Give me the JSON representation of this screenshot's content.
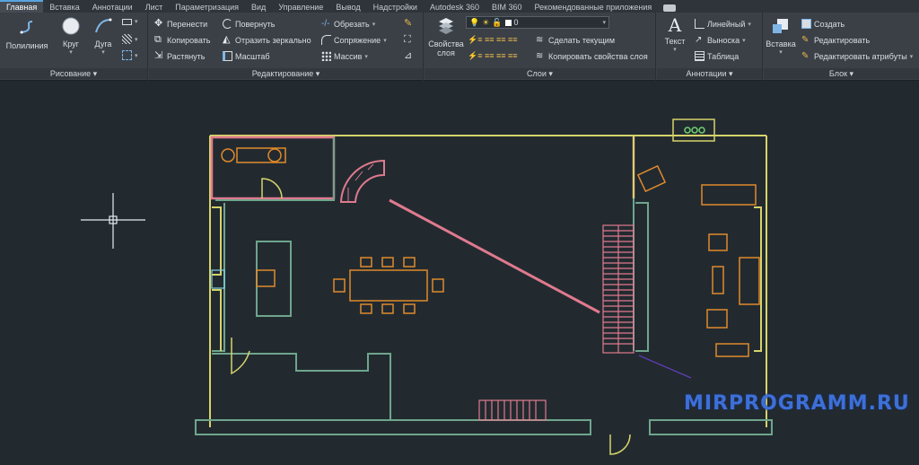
{
  "tabs": [
    "Главная",
    "Вставка",
    "Аннотации",
    "Лист",
    "Параметризация",
    "Вид",
    "Управление",
    "Вывод",
    "Надстройки",
    "Autodesk 360",
    "BIM 360",
    "Рекомендованные приложения"
  ],
  "ribbon": {
    "draw": {
      "title": "Рисование",
      "polyline": "Полилиния",
      "circle": "Круг",
      "arc": "Дуга"
    },
    "modify": {
      "title": "Редактирование",
      "move": "Перенести",
      "rotate": "Повернуть",
      "trim": "Обрезать",
      "copy": "Копировать",
      "mirror": "Отразить зеркально",
      "fillet": "Сопряжение",
      "stretch": "Растянуть",
      "scale": "Масштаб",
      "array": "Массив"
    },
    "layers": {
      "title": "Слои",
      "properties": "Свойства слоя",
      "current_layer": "0",
      "make_current": "Сделать текущим",
      "match_layer": "Копировать свойства слоя"
    },
    "annotation": {
      "title": "Аннотации",
      "text": "Текст",
      "linear": "Линейный",
      "leader": "Выноска",
      "table": "Таблица"
    },
    "block": {
      "title": "Блок",
      "insert": "Вставка",
      "create": "Создать",
      "edit": "Редактировать",
      "edit_attributes": "Редактировать атрибуты"
    }
  },
  "watermark": "MIRPROGRAMM.RU",
  "colors": {
    "ribbon_bg": "#3b4047",
    "canvas_bg": "#222a30",
    "wall_yellow": "#d6d36a",
    "wall_green": "#6fa58c",
    "furniture_orange": "#e08a2a",
    "stair_pink": "#e07a8e",
    "accent_blue": "#58a5df"
  },
  "icons": [
    "polyline-icon",
    "circle-icon",
    "arc-icon",
    "move-icon",
    "rotate-icon",
    "trim-icon",
    "copy-icon",
    "mirror-icon",
    "fillet-icon",
    "stretch-icon",
    "scale-icon",
    "array-icon",
    "layer-properties-icon",
    "text-icon",
    "linear-dimension-icon",
    "leader-icon",
    "table-icon",
    "insert-block-icon",
    "create-block-icon",
    "edit-block-icon",
    "edit-attributes-icon",
    "crosshair-cursor"
  ]
}
